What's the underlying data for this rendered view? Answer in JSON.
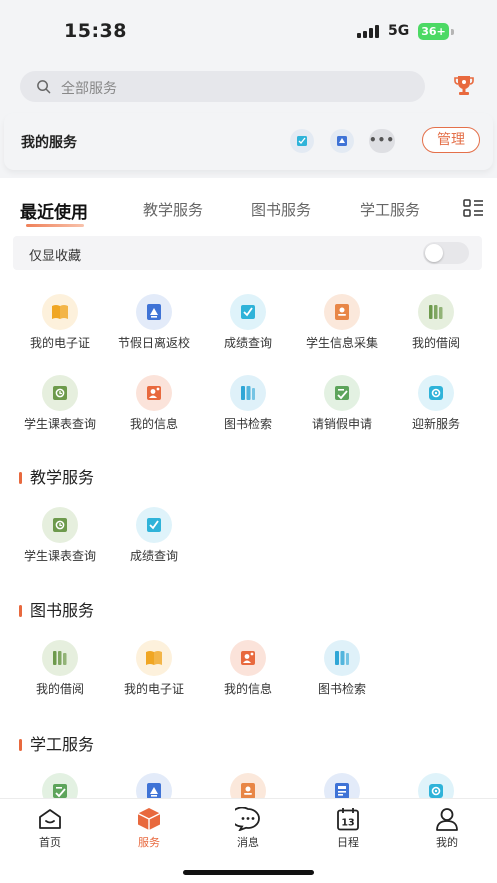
{
  "status_bar": {
    "time": "15:38",
    "network": "5G",
    "battery": "36+"
  },
  "search": {
    "placeholder": "全部服务"
  },
  "my_services": {
    "title": "我的服务",
    "manage_label": "管理"
  },
  "tabs": [
    {
      "label": "最近使用",
      "active": true
    },
    {
      "label": "教学服务",
      "active": false
    },
    {
      "label": "图书服务",
      "active": false
    },
    {
      "label": "学工服务",
      "active": false
    }
  ],
  "favorites_toggle": {
    "label": "仅显收藏",
    "on": false
  },
  "recent": [
    {
      "label": "我的电子证",
      "icon": "book-icon",
      "color": "#f0a623",
      "bg": "#fdf1dc"
    },
    {
      "label": "节假日离返校",
      "icon": "campus-pass-icon",
      "color": "#3f73d6",
      "bg": "#e3ebf9"
    },
    {
      "label": "成绩查询",
      "icon": "grade-icon",
      "color": "#2fb3d9",
      "bg": "#dff3fa"
    },
    {
      "label": "学生信息采集",
      "icon": "student-info-icon",
      "color": "#e88646",
      "bg": "#fbe8db"
    },
    {
      "label": "我的借阅",
      "icon": "bookshelf-icon",
      "color": "#6d9a4c",
      "bg": "#e6efde"
    },
    {
      "label": "学生课表查询",
      "icon": "schedule-icon",
      "color": "#6d9a4c",
      "bg": "#e6efde"
    },
    {
      "label": "我的信息",
      "icon": "my-info-icon",
      "color": "#e8693e",
      "bg": "#fbe3da"
    },
    {
      "label": "图书检索",
      "icon": "library-search-icon",
      "color": "#2fa6d6",
      "bg": "#dff1f9"
    },
    {
      "label": "请销假申请",
      "icon": "leave-request-icon",
      "color": "#5da45b",
      "bg": "#e3f1e2"
    },
    {
      "label": "迎新服务",
      "icon": "welcome-icon",
      "color": "#2fb3d9",
      "bg": "#dff3fa"
    }
  ],
  "sections": [
    {
      "title": "教学服务",
      "items": [
        {
          "label": "学生课表查询",
          "icon": "schedule-icon",
          "color": "#6d9a4c",
          "bg": "#e6efde"
        },
        {
          "label": "成绩查询",
          "icon": "grade-icon",
          "color": "#2fb3d9",
          "bg": "#dff3fa"
        }
      ]
    },
    {
      "title": "图书服务",
      "items": [
        {
          "label": "我的借阅",
          "icon": "bookshelf-icon",
          "color": "#6d9a4c",
          "bg": "#e6efde"
        },
        {
          "label": "我的电子证",
          "icon": "book-icon",
          "color": "#f0a623",
          "bg": "#fdf1dc"
        },
        {
          "label": "我的信息",
          "icon": "my-info-icon",
          "color": "#e8693e",
          "bg": "#fbe3da"
        },
        {
          "label": "图书检索",
          "icon": "library-search-icon",
          "color": "#2fa6d6",
          "bg": "#dff1f9"
        }
      ]
    },
    {
      "title": "学工服务",
      "items": [
        {
          "label": "",
          "icon": "leave-request-icon",
          "color": "#5da45b",
          "bg": "#e3f1e2"
        },
        {
          "label": "",
          "icon": "campus-pass-icon",
          "color": "#3f73d6",
          "bg": "#e3ebf9"
        },
        {
          "label": "",
          "icon": "student-info-icon",
          "color": "#e88646",
          "bg": "#fbe8db"
        },
        {
          "label": "",
          "icon": "id-card-icon",
          "color": "#3f73d6",
          "bg": "#e3ebf9"
        },
        {
          "label": "",
          "icon": "welcome-icon",
          "color": "#2fb3d9",
          "bg": "#dff3fa"
        }
      ]
    }
  ],
  "bottom_nav": [
    {
      "label": "首页",
      "icon": "home-icon",
      "active": false
    },
    {
      "label": "服务",
      "icon": "service-cube-icon",
      "active": true
    },
    {
      "label": "消息",
      "icon": "message-icon",
      "active": false
    },
    {
      "label": "日程",
      "icon": "calendar-icon",
      "active": false,
      "badge_text": "13"
    },
    {
      "label": "我的",
      "icon": "profile-icon",
      "active": false
    }
  ],
  "accent_color": "#e8693e"
}
